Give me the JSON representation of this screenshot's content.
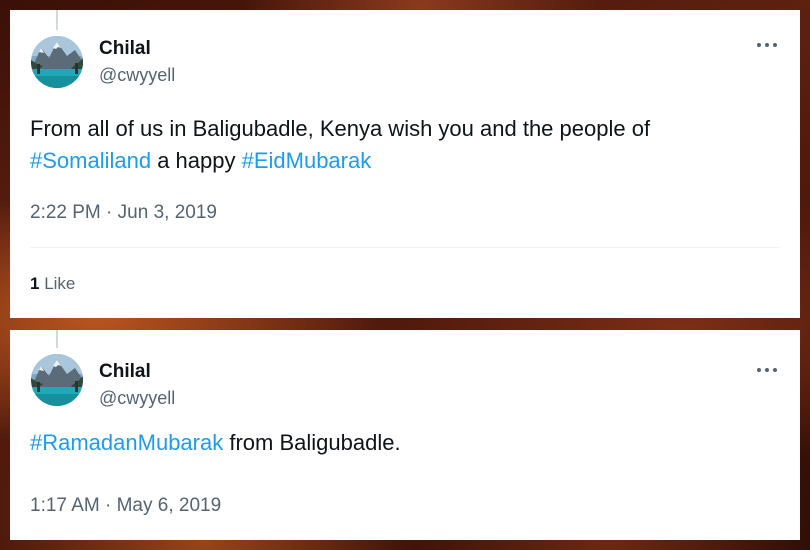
{
  "tweets": [
    {
      "name": "Chilal",
      "handle": "@cwyyell",
      "text": {
        "line1": "From all of us in Baligubadle, Kenya wish you and the people of",
        "tag1": "#Somaliland",
        "mid": " a happy ",
        "tag2": "#EidMubarak"
      },
      "time": "2:22 PM",
      "date": "Jun 3, 2019",
      "likes_count": "1",
      "likes_label": "Like"
    },
    {
      "name": "Chilal",
      "handle": "@cwyyell",
      "text": {
        "tag1": "#RamadanMubarak",
        "rest": " from Baligubadle."
      },
      "time": "1:17 AM",
      "date": "May 6, 2019"
    }
  ],
  "icons": {
    "more": "more-horizontal-icon",
    "avatar": "mountain-lake-avatar"
  },
  "colors": {
    "hashtag": "#1d9bf0",
    "secondary_text": "#536471",
    "primary_text": "#0f1419"
  }
}
